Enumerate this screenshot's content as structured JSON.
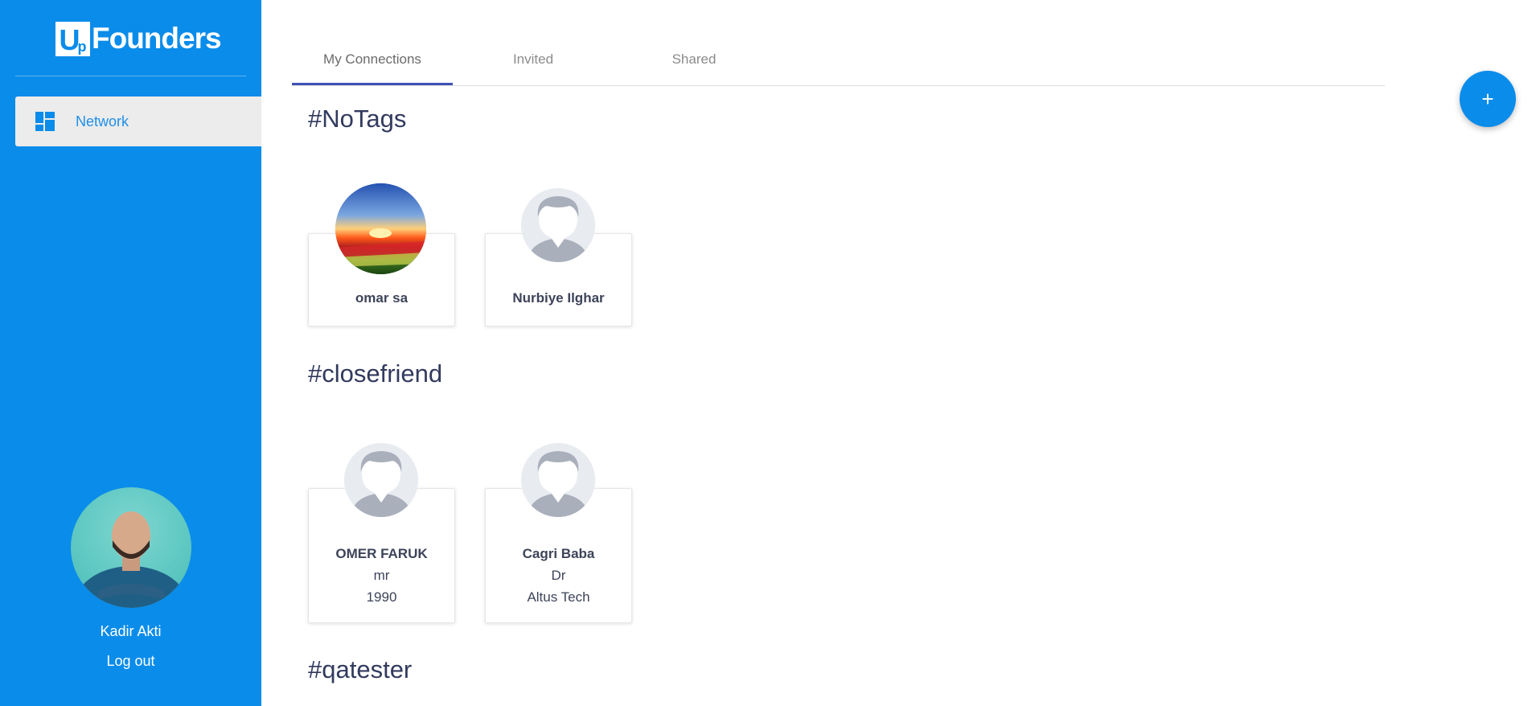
{
  "brand": {
    "logo_letters": "Up",
    "name": "Founders"
  },
  "sidebar": {
    "items": [
      {
        "label": "Network",
        "icon": "dashboard-icon"
      }
    ],
    "user": {
      "name": "Kadir Akti",
      "logout_label": "Log out"
    }
  },
  "tabs": [
    {
      "label": "My Connections",
      "active": true
    },
    {
      "label": "Invited",
      "active": false
    },
    {
      "label": "Shared",
      "active": false
    }
  ],
  "sections": [
    {
      "tag": "#NoTags",
      "cards": [
        {
          "name": "omar sa",
          "avatar": "photo"
        },
        {
          "name": "Nurbiye Ilghar",
          "avatar": "placeholder"
        }
      ]
    },
    {
      "tag": "#closefriend",
      "cards": [
        {
          "name": "OMER FARUK",
          "line2": "mr",
          "line3": "1990",
          "avatar": "placeholder"
        },
        {
          "name": "Cagri Baba",
          "line2": "Dr",
          "line3": "Altus Tech",
          "avatar": "placeholder"
        }
      ]
    },
    {
      "tag": "#qatester",
      "cards": []
    }
  ],
  "fab": {
    "label": "+"
  },
  "colors": {
    "sidebar_bg": "#0a8cea",
    "accent": "#3f51b5",
    "title": "#323a5e"
  }
}
